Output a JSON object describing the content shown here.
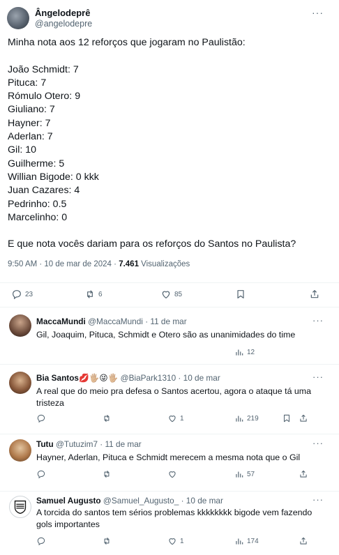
{
  "main": {
    "author_name": "Ângelodeprê",
    "author_handle": "@angelodepre",
    "more": "···",
    "lines": [
      "Minha nota aos 12 reforços que jogaram no Paulistão:",
      "",
      "João Schmidt: 7",
      "Pituca: 7",
      "Rómulo Otero: 9",
      "Giuliano: 7",
      "Hayner: 7",
      "Aderlan: 7",
      "Gil: 10",
      "Guilherme: 5",
      "Willian Bigode: 0 kkk",
      "Juan Cazares: 4",
      "Pedrinho: 0.5",
      "Marcelinho: 0",
      "",
      "E que nota vocês dariam para os reforços do Santos no Paulista?"
    ],
    "time": "9:50 AM · 10 de mar de 2024 · ",
    "views_count": "7.461",
    "views_label": " Visualizações",
    "replies": "23",
    "retweets": "6",
    "likes": "85"
  },
  "replies": [
    {
      "name": "MaccaMundi",
      "handle_date": "@MaccaMundi · 11 de mar",
      "text": "Gil, Joaquim, Pituca, Schmidt e Otero são as unanimidades do time",
      "replies": "",
      "retweets": "",
      "likes": "",
      "views": "12"
    },
    {
      "name": "Bia Santos💋🖐🏼😜🖐🏼",
      "handle_date": "@BiaPark1310 · 10 de mar",
      "text": "A real que do meio pra defesa o Santos acertou, agora o ataque tá uma tristeza",
      "replies": "",
      "retweets": "",
      "likes": "1",
      "views": "219"
    },
    {
      "name": "Tutu",
      "handle_date": "@Tutuzim7 · 11 de mar",
      "text": "Hayner, Aderlan, Pituca e Schmidt merecem a mesma nota que o Gil",
      "replies": "",
      "retweets": "",
      "likes": "",
      "views": "57"
    },
    {
      "name": "Samuel Augusto",
      "handle_date": "@Samuel_Augusto_ · 10 de mar",
      "text": "A torcida do santos tem sérios problemas kkkkkkkk bigode vem fazendo gols importantes",
      "replies": "",
      "retweets": "",
      "likes": "1",
      "views": "174"
    }
  ],
  "colors": {
    "text": "#0f1419",
    "secondary": "#536471",
    "divider": "#eff3f4"
  }
}
